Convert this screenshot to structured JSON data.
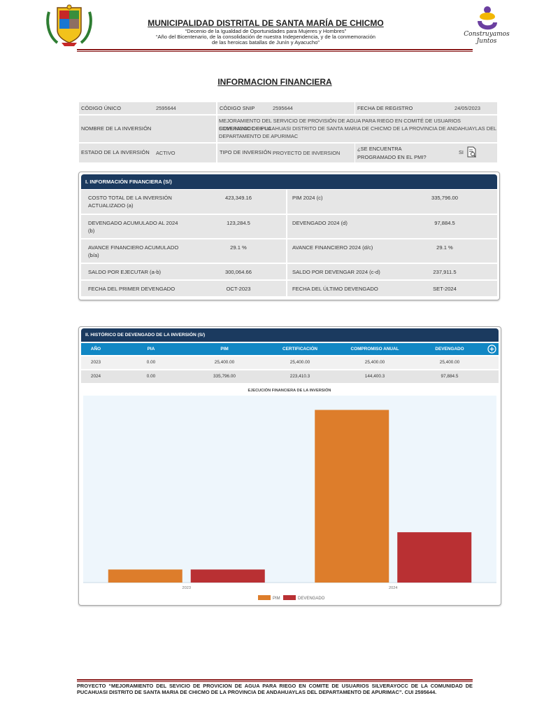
{
  "header": {
    "title": "MUNICIPALIDAD DISTRITAL DE SANTA MARÍA DE CHICMO",
    "line1": "“Decenio de la Igualdad de Oportunidades para Mujeres y Hombres”",
    "line2": "“Año del Bicentenario, de la consolidación de nuestra Independencia, y de la conmemoración",
    "line3": "de las heroicas batallas de Junín y Ayacucho”",
    "right_logo_text": "Construyamos Juntos"
  },
  "doc_title": "INFORMACION FINANCIERA",
  "general": {
    "codigo_unico_label": "CÓDIGO ÚNICO",
    "codigo_unico": "2595644",
    "codigo_snip_label": "CÓDIGO SNIP",
    "codigo_snip": "2595644",
    "fecha_registro_label": "FECHA DE REGISTRO",
    "fecha_registro": "24/05/2023",
    "nombre_label": "NOMBRE DE LA INVERSIÓN",
    "nombre_l1": "MEJORAMIENTO DEL SERVICIO DE PROVISIÓN DE AGUA PARA RIEGO EN COMITÉ DE USUARIOS SILVERAYOCC DE LA",
    "nombre_l2": "COMUNIDAD DE PUCAHUASI DISTRITO DE SANTA MARIA DE CHICMO DE LA PROVINCIA DE ANDAHUAYLAS DEL",
    "nombre_l3": "DEPARTAMENTO DE APURIMAC",
    "estado_label": "ESTADO DE LA INVERSIÓN",
    "estado": "ACTIVO",
    "tipo_label": "TIPO DE INVERSIÓN",
    "tipo": "PROYECTO DE INVERSION",
    "pmi_label_1": "¿SE ENCUENTRA",
    "pmi_label_2": "PROGRAMADO EN EL PMI?",
    "pmi": "SI"
  },
  "financiera": {
    "title": "I. INFORMACIÓN FINANCIERA (S/)",
    "rows": [
      {
        "l1": "COSTO TOTAL DE LA INVERSIÓN",
        "l2": "ACTUALIZADO (a)",
        "v1": "423,349.16",
        "r1": "PIM 2024 (c)",
        "v2": "335,796.00"
      },
      {
        "l1": "DEVENGADO ACUMULADO AL 2024",
        "l2": "(b)",
        "v1": "123,284.5",
        "r1": "DEVENGADO 2024 (d)",
        "v2": "97,884.5"
      },
      {
        "l1": "AVANCE FINANCIERO ACUMULADO",
        "l2": "(b/a)",
        "v1": "29.1 %",
        "r1": "AVANCE FINANCIERO 2024 (d/c)",
        "v2": "29.1 %"
      },
      {
        "l1": "SALDO POR EJECUTAR (a-b)",
        "l2": "",
        "v1": "300,064.66",
        "r1": "SALDO POR DEVENGAR 2024 (c-d)",
        "v2": "237,911.5"
      },
      {
        "l1": "FECHA DEL PRIMER DEVENGADO",
        "l2": "",
        "v1": "OCT-2023",
        "r1": "FECHA DEL ÚLTIMO DEVENGADO",
        "v2": "SET-2024"
      }
    ]
  },
  "historico": {
    "title": "II. HISTÓRICO DE DEVENGADO DE LA INVERSIÓN (S/)",
    "headers": [
      "AÑO",
      "PIA",
      "PIM",
      "CERTIFICACIÓN",
      "COMPROMISO ANUAL",
      "DEVENGADO"
    ],
    "rows": [
      [
        "2023",
        "0.00",
        "25,400.00",
        "25,400.00",
        "25,400.00",
        "25,400.00"
      ],
      [
        "2024",
        "0.00",
        "335,796.00",
        "223,410.3",
        "144,400.3",
        "97,884.5"
      ]
    ]
  },
  "chart_data": {
    "type": "bar",
    "title": "EJECUCIÓN FINANCIERA DE LA INVERSIÓN",
    "categories": [
      "2023",
      "2024"
    ],
    "series": [
      {
        "name": "PIM",
        "values": [
          25400,
          335796
        ],
        "color": "#dd7d2b"
      },
      {
        "name": "DEVENGADO",
        "values": [
          25400,
          97884.5
        ],
        "color": "#b93033"
      }
    ],
    "ylim": [
      0,
      350000
    ],
    "legend": "bottom",
    "grid": false
  },
  "footer": {
    "text": "PROYECTO “MEJORAMIENTO DEL SEVICIO DE PROVICION DE AGUA PARA RIEGO EN COMITE DE USUARIOS SILVERAYOCC DE LA COMUNIDAD DE PUCAHUASI DISTRITO DE SANTA MARIA DE CHICMO DE LA PROVINCIA DE ANDAHUAYLAS DEL DEPARTAMENTO DE APURIMAC”. CUI 2595644."
  }
}
